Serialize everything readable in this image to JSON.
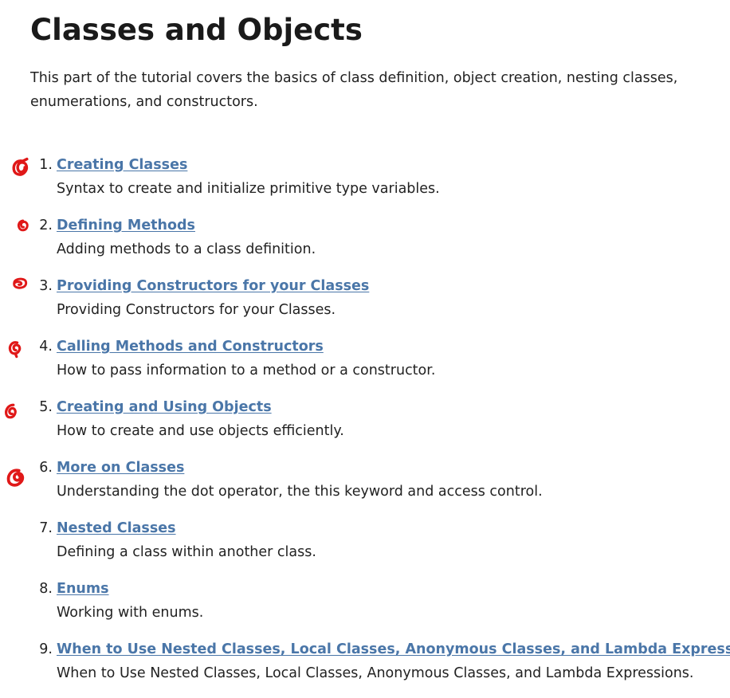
{
  "heading": "Classes and Objects",
  "intro": "This part of the tutorial covers the basics of class definition, object creation, nesting classes, enumerations, and constructors.",
  "annotation_color": "#e01818",
  "link_color": "#4a76a8",
  "items": [
    {
      "number": "1.",
      "link": "Creating Classes",
      "description": "Syntax to create and initialize primitive type variables.",
      "marked": true
    },
    {
      "number": "2.",
      "link": "Defining Methods",
      "description": "Adding methods to a class definition.",
      "marked": true
    },
    {
      "number": "3.",
      "link": "Providing Constructors for your Classes",
      "description": "Providing Constructors for your Classes.",
      "marked": true
    },
    {
      "number": "4.",
      "link": "Calling Methods and Constructors",
      "description": "How to pass information to a method or a constructor.",
      "marked": true
    },
    {
      "number": "5.",
      "link": "Creating and Using Objects",
      "description": "How to create and use objects efficiently.",
      "marked": true
    },
    {
      "number": "6.",
      "link": "More on Classes",
      "description": "Understanding the dot operator, the this keyword and access control.",
      "marked": true
    },
    {
      "number": "7.",
      "link": "Nested Classes",
      "description": "Defining a class within another class.",
      "marked": false
    },
    {
      "number": "8.",
      "link": "Enums",
      "description": "Working with enums.",
      "marked": false
    },
    {
      "number": "9.",
      "link": "When to Use Nested Classes, Local Classes, Anonymous Classes, and Lambda Expressions",
      "description": "When to Use Nested Classes, Local Classes, Anonymous Classes, and Lambda Expressions.",
      "marked": false
    }
  ]
}
